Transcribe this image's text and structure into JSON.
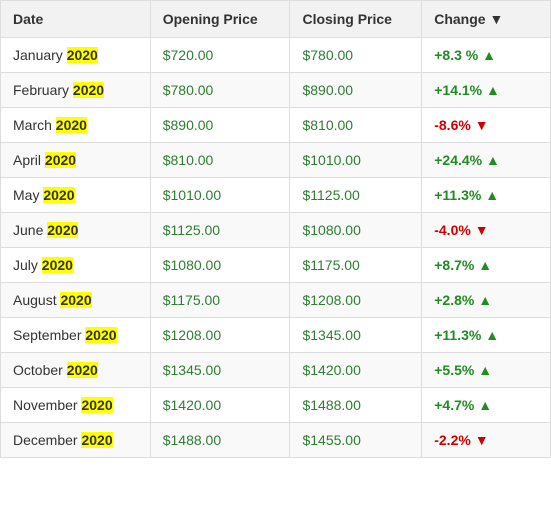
{
  "table": {
    "headers": [
      "Date",
      "Opening Price",
      "Closing Price",
      "Change ▼"
    ],
    "rows": [
      {
        "month": "January",
        "year": "2020",
        "open": "$720.00",
        "close": "$780.00",
        "change": "+8.3 %",
        "positive": true
      },
      {
        "month": "February",
        "year": "2020",
        "open": "$780.00",
        "close": "$890.00",
        "change": "+14.1%",
        "positive": true
      },
      {
        "month": "March",
        "year": "2020",
        "open": "$890.00",
        "close": "$810.00",
        "change": "-8.6%",
        "positive": false
      },
      {
        "month": "April",
        "year": "2020",
        "open": "$810.00",
        "close": "$1010.00",
        "change": "+24.4%",
        "positive": true
      },
      {
        "month": "May",
        "year": "2020",
        "open": "$1010.00",
        "close": "$1125.00",
        "change": "+11.3%",
        "positive": true
      },
      {
        "month": "June",
        "year": "2020",
        "open": "$1125.00",
        "close": "$1080.00",
        "change": "-4.0%",
        "positive": false
      },
      {
        "month": "July",
        "year": "2020",
        "open": "$1080.00",
        "close": "$1175.00",
        "change": "+8.7%",
        "positive": true
      },
      {
        "month": "August",
        "year": "2020",
        "open": "$1175.00",
        "close": "$1208.00",
        "change": "+2.8%",
        "positive": true
      },
      {
        "month": "September",
        "year": "2020",
        "open": "$1208.00",
        "close": "$1345.00",
        "change": "+11.3%",
        "positive": true
      },
      {
        "month": "October",
        "year": "2020",
        "open": "$1345.00",
        "close": "$1420.00",
        "change": "+5.5%",
        "positive": true
      },
      {
        "month": "November",
        "year": "2020",
        "open": "$1420.00",
        "close": "$1488.00",
        "change": "+4.7%",
        "positive": true
      },
      {
        "month": "December",
        "year": "2020",
        "open": "$1488.00",
        "close": "$1455.00",
        "change": "-2.2%",
        "positive": false
      }
    ]
  }
}
